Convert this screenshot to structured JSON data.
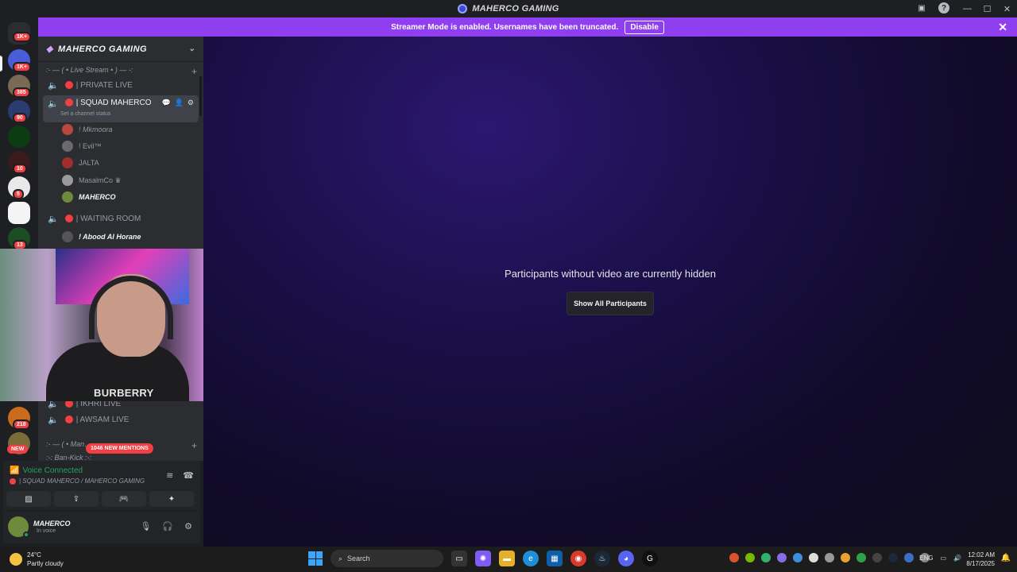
{
  "window": {
    "title": "MAHERCO GAMING"
  },
  "banner": {
    "text": "Streamer Mode is enabled. Usernames have been truncated.",
    "disable_label": "Disable"
  },
  "servers": [
    {
      "badge": "1K+"
    },
    {
      "badge": "1K+"
    },
    {
      "badge": "385"
    },
    {
      "badge": "90"
    },
    {
      "badge": ""
    },
    {
      "badge": "10"
    },
    {
      "badge": "5"
    },
    {
      "badge": ""
    },
    {
      "badge": "13"
    },
    {
      "badge": "218"
    }
  ],
  "new_tag": "NEW",
  "server_header": {
    "name": "MAHERCO GAMING"
  },
  "categories": [
    {
      "label": ":- — ( • Live Stream • ) — -:"
    },
    {
      "label": ":- — ( • Man…"
    },
    {
      "label": ":-:  Ban-Kick  :-:"
    }
  ],
  "channels": {
    "private_live": "| PRIVATE LIVE",
    "squad": "| SQUAD MAHERCO",
    "squad_status": "Set a channel status",
    "waiting": "| WAITING ROOM",
    "ikhri": "| IKHRI LIVE",
    "awsam": "| AWSAM LIVE"
  },
  "members": [
    {
      "name": "! Mkmoora",
      "color": "#b8473f"
    },
    {
      "name": "! Evil™",
      "color": "#6b6b6b"
    },
    {
      "name": "JALTA",
      "color": "#a12d2d"
    },
    {
      "name": "MasalmCo ♛",
      "color": "#9a9a9a"
    },
    {
      "name": "MAHERCO",
      "color": "#6e8b3d"
    },
    {
      "name": "! Abood Al Horane",
      "color": "#555555"
    }
  ],
  "mentions": "1046 NEW MENTIONS",
  "voice": {
    "connected": "Voice Connected",
    "location": "| SQUAD MAHERCO / MAHERCO GAMING"
  },
  "user": {
    "name": "MAHERCO",
    "status": "In voice"
  },
  "stage": {
    "message": "Participants without video are currently hidden",
    "button": "Show All Participants"
  },
  "webcam": {
    "shirt_text": "BURBERRY"
  },
  "taskbar": {
    "weather_temp": "24°C",
    "weather_desc": "Partly cloudy",
    "search_placeholder": "Search",
    "lang": "ENG",
    "time": "12:02 AM",
    "date": "8/17/2025"
  }
}
